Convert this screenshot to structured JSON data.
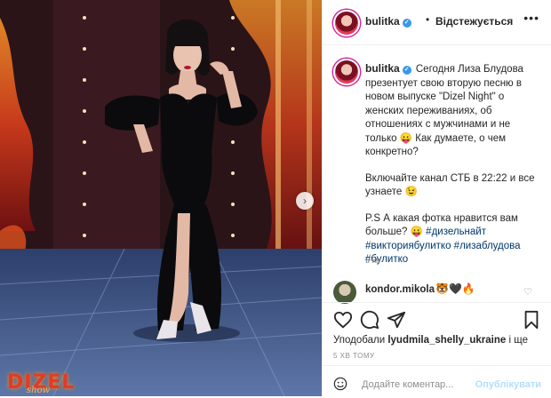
{
  "header": {
    "username": "bulitka",
    "separator": "•",
    "follow_label": "Відстежується",
    "more": "•••"
  },
  "caption": {
    "username": "bulitka",
    "paragraph1": "Сегодня Лиза Блудова презентует свою вторую песню в новом выпуске \"Dizel Night\" о женских переживаниях, об отношениях с мужчинами и не только 😛 Как думаете, о чем конкретно?",
    "paragraph2": "Включайте канал СТБ в 22:22 и все узнаете 😉",
    "paragraph3": "P.S А какая фотка нравится вам больше? 😛",
    "hashtags": [
      "#дизельнайт",
      "#викториябулитко",
      "#лизаблудова",
      "#булитко"
    ],
    "time": "5 хв"
  },
  "comment": {
    "username": "kondor.mikola",
    "text": "🐯🖤🔥",
    "like_icon": "heart-outline-icon"
  },
  "actions": {
    "icons": [
      "heart-icon",
      "comment-icon",
      "share-icon",
      "bookmark-icon"
    ],
    "liked_prefix": "Уподобали",
    "liked_user": "lyudmila_shelly_ukraine",
    "liked_suffix": "і ще",
    "date": "5 ХВ ТОМУ"
  },
  "add_comment": {
    "placeholder": "Додайте коментар...",
    "publish_label": "Опублікувати"
  },
  "photo": {
    "logo": "DIZEL",
    "logo_sub": "show"
  },
  "colors": {
    "link": "#00376b",
    "verified": "#3897f0",
    "publish_disabled": "#b2dffc",
    "muted": "#8e8e8e"
  }
}
